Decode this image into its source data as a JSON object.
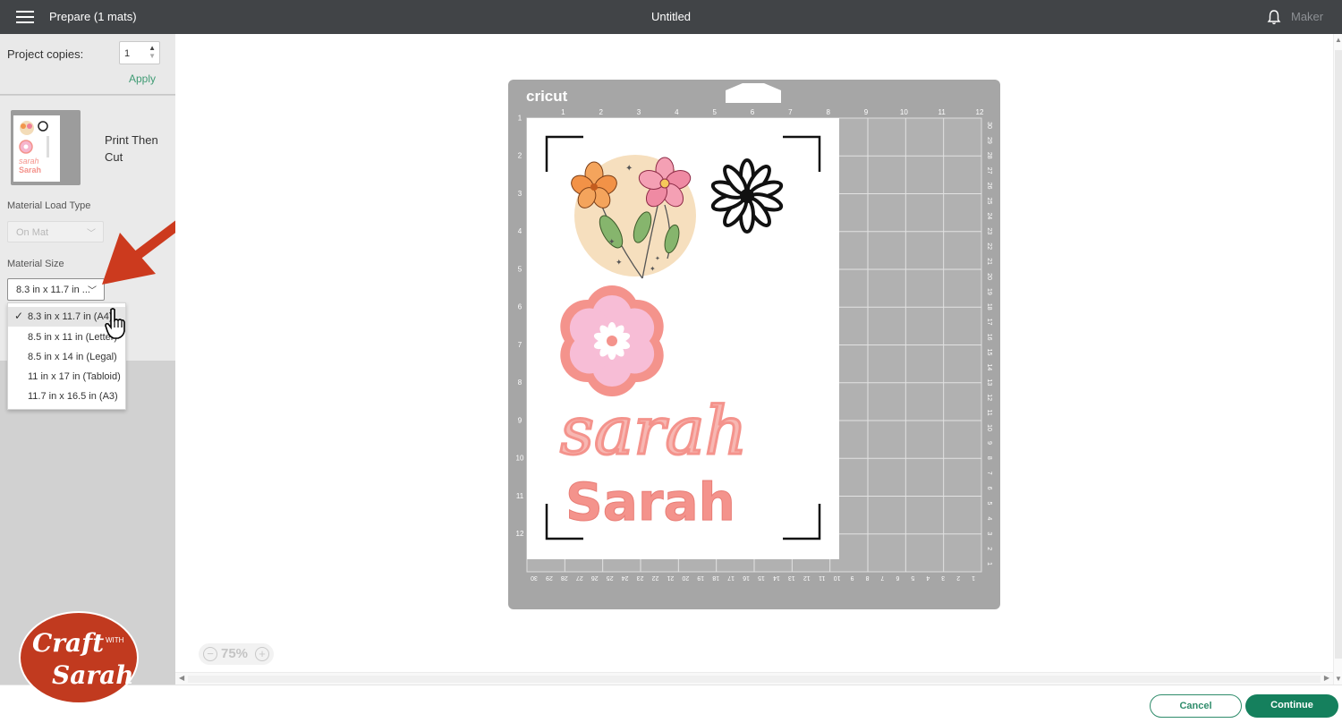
{
  "topbar": {
    "prepare_title": "Prepare (1 mats)",
    "document_title": "Untitled",
    "machine_label": "Maker"
  },
  "sidebar": {
    "copies_label": "Project copies:",
    "copies_value": "1",
    "apply_label": "Apply",
    "mat_mode": "Print Then Cut",
    "thumb_text": "sarah Sarah",
    "material_load_type_label": "Material Load Type",
    "material_load_type_value": "On Mat",
    "material_size_label": "Material Size",
    "material_size_value": "8.3 in x 11.7 in ...",
    "material_size_options": [
      "8.3 in x 11.7 in (A4)",
      "8.5 in x 11 in (Letter)",
      "8.5 in x 14 in (Legal)",
      "11 in x 17 in (Tabloid)",
      "11.7 in x 16.5 in (A3)"
    ]
  },
  "mat": {
    "brand": "cricut",
    "top_ruler": [
      "1",
      "2",
      "3",
      "4",
      "5",
      "6",
      "7",
      "8",
      "9",
      "10",
      "11",
      "12"
    ],
    "left_ruler": [
      "1",
      "2",
      "3",
      "4",
      "5",
      "6",
      "7",
      "8",
      "9",
      "10",
      "11",
      "12"
    ],
    "right_ruler": [
      "30",
      "29",
      "28",
      "27",
      "26",
      "25",
      "24",
      "23",
      "22",
      "21",
      "20",
      "19",
      "18",
      "17",
      "16",
      "15",
      "14",
      "13",
      "12",
      "11",
      "10",
      "9",
      "8",
      "7",
      "6",
      "5",
      "4",
      "3",
      "2",
      "1"
    ],
    "bottom_ruler": [
      "30",
      "29",
      "28",
      "27",
      "26",
      "25",
      "24",
      "23",
      "22",
      "21",
      "20",
      "19",
      "18",
      "17",
      "16",
      "15",
      "14",
      "13",
      "12",
      "11",
      "10",
      "9",
      "8",
      "7",
      "6",
      "5",
      "4",
      "3",
      "2",
      "1"
    ],
    "script_name": "sarah",
    "bold_name": "Sarah"
  },
  "zoom": {
    "minus": "−",
    "value": "75%",
    "plus": "+"
  },
  "footer": {
    "cancel_label": "Cancel",
    "continue_label": "Continue"
  },
  "watermark": {
    "line1": "Craft",
    "with": "WITH",
    "line2": "Sarah"
  },
  "colors": {
    "accent_green": "#15805d",
    "topbar": "#414447",
    "annotation_arrow": "#cc3a1e",
    "name_pink": "#f4938c"
  }
}
